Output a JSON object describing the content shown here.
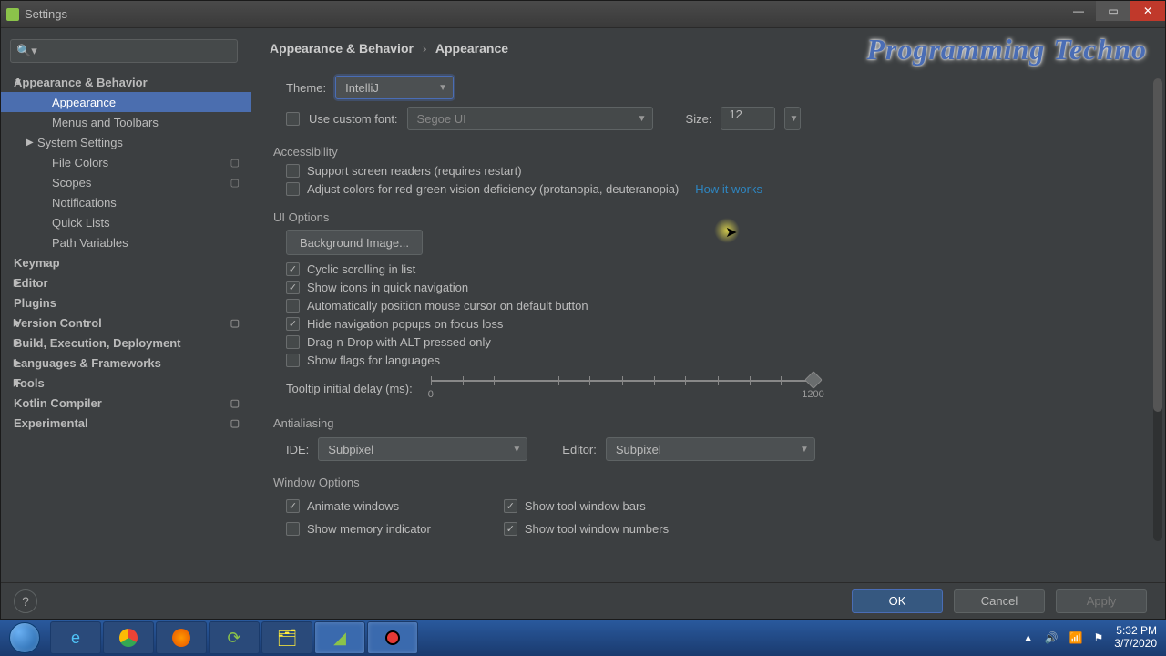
{
  "window": {
    "title": "Settings"
  },
  "brand": "Programming Techno",
  "breadcrumb": {
    "a": "Appearance & Behavior",
    "b": "Appearance"
  },
  "sidebar": {
    "search_placeholder": "",
    "items": [
      {
        "label": "Appearance & Behavior",
        "lvl": 1,
        "arrow": "▼"
      },
      {
        "label": "Appearance",
        "lvl": 2,
        "sel": true
      },
      {
        "label": "Menus and Toolbars",
        "lvl": 2
      },
      {
        "label": "System Settings",
        "lvl": 2,
        "arrow": "▶",
        "indent": "lvl2b"
      },
      {
        "label": "File Colors",
        "lvl": 2,
        "mod": true
      },
      {
        "label": "Scopes",
        "lvl": 2,
        "mod": true
      },
      {
        "label": "Notifications",
        "lvl": 2
      },
      {
        "label": "Quick Lists",
        "lvl": 2
      },
      {
        "label": "Path Variables",
        "lvl": 2
      },
      {
        "label": "Keymap",
        "lvl": 1
      },
      {
        "label": "Editor",
        "lvl": 1,
        "arrow": "▶"
      },
      {
        "label": "Plugins",
        "lvl": 1
      },
      {
        "label": "Version Control",
        "lvl": 1,
        "arrow": "▶",
        "mod": true
      },
      {
        "label": "Build, Execution, Deployment",
        "lvl": 1,
        "arrow": "▶"
      },
      {
        "label": "Languages & Frameworks",
        "lvl": 1,
        "arrow": "▶"
      },
      {
        "label": "Tools",
        "lvl": 1,
        "arrow": "▶"
      },
      {
        "label": "Kotlin Compiler",
        "lvl": 1,
        "mod": true
      },
      {
        "label": "Experimental",
        "lvl": 1,
        "mod": true
      }
    ]
  },
  "theme": {
    "label": "Theme:",
    "value": "IntelliJ"
  },
  "customFont": {
    "checked": false,
    "label": "Use custom font:",
    "value": "Segoe UI",
    "sizeLabel": "Size:",
    "sizeValue": "12"
  },
  "accessibility": {
    "header": "Accessibility",
    "screenReaders": {
      "checked": false,
      "label": "Support screen readers (requires restart)"
    },
    "colorDef": {
      "checked": false,
      "label": "Adjust colors for red-green vision deficiency (protanopia, deuteranopia)",
      "link": "How it works"
    }
  },
  "uiOptions": {
    "header": "UI Options",
    "bgBtn": "Background Image...",
    "opts": [
      {
        "checked": true,
        "label": "Cyclic scrolling in list"
      },
      {
        "checked": true,
        "label": "Show icons in quick navigation"
      },
      {
        "checked": false,
        "label": "Automatically position mouse cursor on default button"
      },
      {
        "checked": true,
        "label": "Hide navigation popups on focus loss"
      },
      {
        "checked": false,
        "label": "Drag-n-Drop with ALT pressed only"
      },
      {
        "checked": false,
        "label": "Show flags for languages"
      }
    ],
    "tooltipLabel": "Tooltip initial delay (ms):",
    "slider": {
      "min": "0",
      "max": "1200"
    }
  },
  "antialiasing": {
    "header": "Antialiasing",
    "ideLabel": "IDE:",
    "ideValue": "Subpixel",
    "editorLabel": "Editor:",
    "editorValue": "Subpixel"
  },
  "windowOptions": {
    "header": "Window Options",
    "left": [
      {
        "checked": true,
        "label": "Animate windows"
      },
      {
        "checked": false,
        "label": "Show memory indicator"
      }
    ],
    "right": [
      {
        "checked": true,
        "label": "Show tool window bars"
      },
      {
        "checked": true,
        "label": "Show tool window numbers"
      }
    ]
  },
  "footer": {
    "ok": "OK",
    "cancel": "Cancel",
    "apply": "Apply",
    "help": "?"
  },
  "taskbar": {
    "time": "5:32 PM",
    "date": "3/7/2020"
  }
}
